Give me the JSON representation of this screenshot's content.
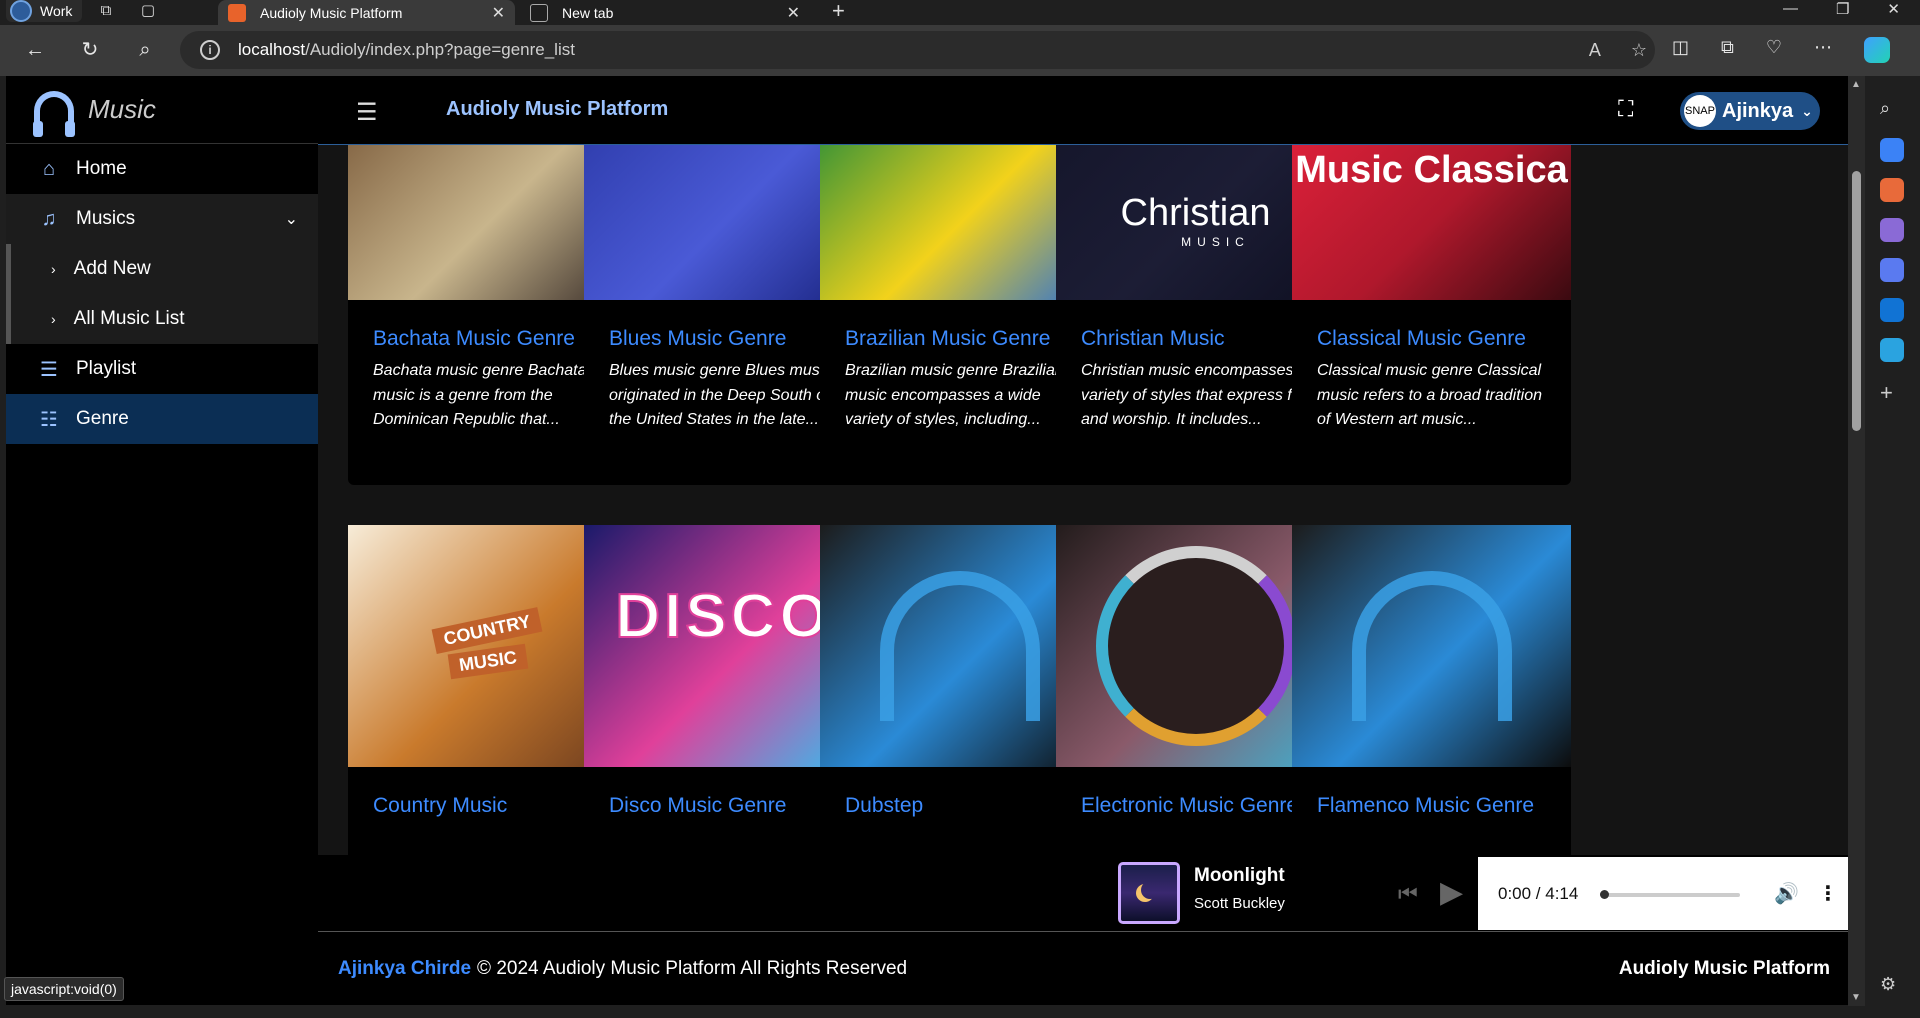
{
  "browser": {
    "workspace": "Work",
    "tabs": [
      {
        "title": "Audioly Music Platform",
        "active": true
      },
      {
        "title": "New tab",
        "active": false
      }
    ],
    "url_host": "localhost",
    "url_path": "/Audioly/index.php?page=genre_list",
    "status_url": "javascript:void(0)"
  },
  "sidebar": {
    "brand": "Music",
    "items": [
      {
        "label": "Home",
        "icon": "home-icon"
      },
      {
        "label": "Musics",
        "icon": "music-note-icon"
      },
      {
        "label": "Add New",
        "icon": "chevron-right-icon"
      },
      {
        "label": "All Music List",
        "icon": "chevron-right-icon"
      },
      {
        "label": "Playlist",
        "icon": "list-icon"
      },
      {
        "label": "Genre",
        "icon": "list-grid-icon"
      }
    ]
  },
  "topbar": {
    "title": "Audioly Music Platform",
    "user": "Ajinkya",
    "avatar_text": "SNAP"
  },
  "genres": [
    {
      "title": "Bachata Music Genre",
      "desc": "Bachata music genre Bachata music is a genre from the Dominican Republic that...",
      "colors": [
        "#7a5a3a",
        "#c8b58c",
        "#3a2f2a"
      ]
    },
    {
      "title": "Blues Music Genre",
      "desc": "Blues music genre Blues music originated in the Deep South of the United States in the late...",
      "colors": [
        "#2c3aa8",
        "#4a5ad6",
        "#1a2480"
      ]
    },
    {
      "title": "Brazilian Music Genre",
      "desc": "Brazilian music genre Brazilian music encompasses a wide variety of styles, including...",
      "colors": [
        "#1f8a3a",
        "#f2d21b",
        "#2a6fd6"
      ]
    },
    {
      "title": "Christian Music",
      "desc": "Christian music encompasses a variety of styles that express faith and worship. It includes...",
      "colors": [
        "#14152a",
        "#1c1d35",
        "#0f1022"
      ]
    },
    {
      "title": "Classical Music Genre",
      "desc": "Classical music genre Classical music refers to a broad tradition of Western art music...",
      "colors": [
        "#e3223c",
        "#b0182c",
        "#3a0a10"
      ]
    },
    {
      "title": "Country Music",
      "desc": "",
      "colors": [
        "#f7ecd8",
        "#c97a2c",
        "#6b3b1e"
      ]
    },
    {
      "title": "Disco Music Genre",
      "desc": "",
      "colors": [
        "#1a1a6a",
        "#e0409a",
        "#30c0f0"
      ]
    },
    {
      "title": "Dubstep",
      "desc": "",
      "colors": [
        "#1c1c1c",
        "#2a8ad6",
        "#0c0c0c"
      ]
    },
    {
      "title": "Electronic Music Genre",
      "desc": "",
      "colors": [
        "#231c1c",
        "#8a5a6a",
        "#3fb0d0"
      ]
    },
    {
      "title": "Flamenco Music Genre",
      "desc": "",
      "colors": [
        "#1c1c1c",
        "#2a8ad6",
        "#0c0c0c"
      ]
    }
  ],
  "image_captions": {
    "christian": "Christian",
    "christian_sub": "MUSIC",
    "classical": "Music Classica",
    "country_1": "COUNTRY",
    "country_2": "MUSIC",
    "disco": "DISCO"
  },
  "player": {
    "song": "Moonlight",
    "artist": "Scott Buckley",
    "time": "0:00 / 4:14",
    "progress": 0
  },
  "footer": {
    "author": "Ajinkya Chirde",
    "copyright": "© 2024 Audioly Music Platform All Rights Reserved",
    "right": "Audioly Music Platform"
  }
}
